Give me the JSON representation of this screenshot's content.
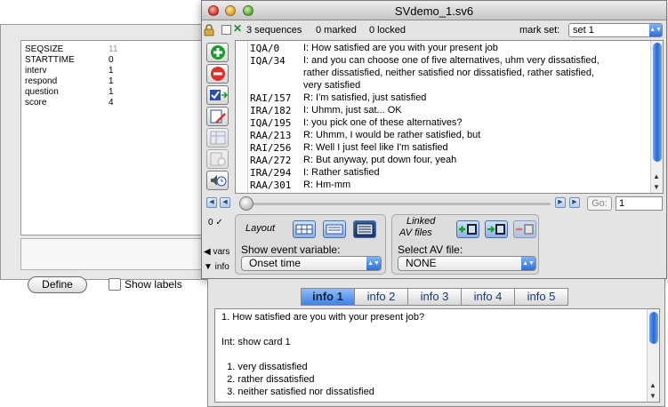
{
  "bg_window": {
    "vars": [
      {
        "name": "SEQSIZE",
        "value": "11",
        "dim": true
      },
      {
        "name": "STARTTIME",
        "value": "0"
      },
      {
        "name": "interv",
        "value": "1"
      },
      {
        "name": "respond",
        "value": "1"
      },
      {
        "name": "question",
        "value": "1"
      },
      {
        "name": "score",
        "value": "4"
      }
    ],
    "define_label": "Define",
    "show_labels": "Show labels"
  },
  "main_window": {
    "title": "SVdemo_1.sv6",
    "seq_count": "3 sequences",
    "marked_count": "0 marked",
    "locked_count": "0 locked",
    "markset_label": "mark set:",
    "markset_value": "set 1",
    "rows": [
      {
        "id": "IQA/0",
        "text": "I: How satisfied are you with your present job"
      },
      {
        "id": "IQA/34",
        "text": "I: and you can choose one of five alternatives, uhm very dissatisfied,"
      },
      {
        "id": "",
        "text": "rather dissatisfied, neither satisfied nor dissatisfied, rather satisfied,"
      },
      {
        "id": "",
        "text": "very satisfied"
      },
      {
        "id": "RAI/157",
        "text": "R: I'm satisfied, just satisfied"
      },
      {
        "id": "IRA/182",
        "text": "I: Uhmm, just sat... OK"
      },
      {
        "id": "IQA/195",
        "text": "I: you pick one of these alternatives?"
      },
      {
        "id": "RAA/213",
        "text": "R: Uhmm, I would be rather satisfied, but"
      },
      {
        "id": "RAI/256",
        "text": "R: Well I just feel like I'm satisfied"
      },
      {
        "id": "RAA/272",
        "text": "R: But anyway, put down four, yeah"
      },
      {
        "id": "IRA/294",
        "text": "I: Rather satisfied"
      },
      {
        "id": "RAA/301",
        "text": "R: Hm-mm"
      }
    ],
    "go_label": "Go:",
    "go_value": "1",
    "zero_mark": "0 ✓",
    "vars_toggle": "◀ vars",
    "info_toggle": "▼ info",
    "layout_title": "Layout",
    "event_var_label": "Show event variable:",
    "event_var_value": "Onset time",
    "av_title_1": "Linked",
    "av_title_2": "AV files",
    "av_file_label": "Select AV file:",
    "av_file_value": "NONE",
    "colors": {
      "accent": "#3f82e6",
      "add": "#1a9c2e",
      "remove": "#d8322a"
    }
  },
  "drawer": {
    "tabs": [
      "info 1",
      "info 2",
      "info 3",
      "info 4",
      "info 5"
    ],
    "active_tab": 0,
    "lines": [
      "1. How satisfied are you with your present job?",
      "",
      "Int: show card 1",
      "",
      "  1. very dissatisfied",
      "  2. rather dissatisfied",
      "  3. neither satisfied nor dissatisfied"
    ]
  }
}
